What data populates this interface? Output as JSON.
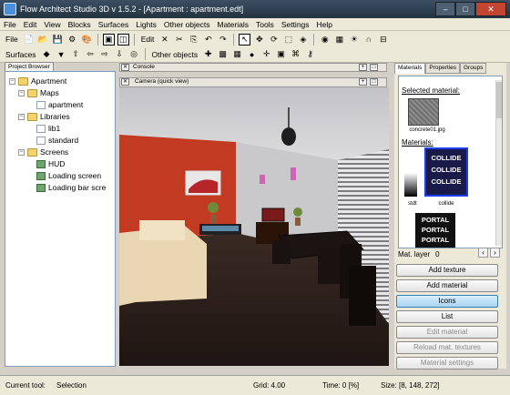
{
  "window": {
    "title": "Flow Architect Studio 3D v 1.5.2  - [Apartment : apartment.edt]",
    "minimize": "–",
    "maximize": "□",
    "close": "✕"
  },
  "menu": [
    "File",
    "Edit",
    "View",
    "Blocks",
    "Surfaces",
    "Lights",
    "Other objects",
    "Materials",
    "Tools",
    "Settings",
    "Help"
  ],
  "toolbar": {
    "file_label": "File",
    "edit_label": "Edit",
    "surfaces_label": "Surfaces",
    "other_objects_label": "Other objects"
  },
  "project_browser": {
    "tab": "Project Browser",
    "tree": {
      "root": "Apartment",
      "maps_label": "Maps",
      "maps": [
        "apartment"
      ],
      "libraries_label": "Libraries",
      "libraries": [
        "lib1",
        "standard"
      ],
      "screens_label": "Screens",
      "screens": [
        "HUD",
        "Loading screen",
        "Loading bar scre"
      ]
    }
  },
  "console": {
    "title": "Console"
  },
  "camera": {
    "title": "Camera (quick view)"
  },
  "materials_panel": {
    "tabs": [
      "Materials",
      "Properties",
      "Groups"
    ],
    "selected_label": "Selected material:",
    "selected_name": "concrete01.jpg",
    "materials_label": "Materials:",
    "items": [
      {
        "name": "stdt",
        "lines": []
      },
      {
        "name": "collide",
        "lines": [
          "COLLIDE",
          "COLLIDE",
          "COLLIDE"
        ]
      },
      {
        "name": "",
        "lines": [
          "PORTAL",
          "PORTAL",
          "PORTAL"
        ]
      }
    ],
    "mat_layer_label": "Mat. layer",
    "mat_layer_value": "0",
    "buttons": [
      {
        "label": "Add texture",
        "state": "normal"
      },
      {
        "label": "Add material",
        "state": "normal"
      },
      {
        "label": "Icons",
        "state": "selected"
      },
      {
        "label": "List",
        "state": "normal"
      },
      {
        "label": "Edit material",
        "state": "disabled"
      },
      {
        "label": "Reload mat. textures",
        "state": "disabled"
      },
      {
        "label": "Material settings",
        "state": "disabled"
      }
    ]
  },
  "status": {
    "current_tool_label": "Current tool:",
    "current_tool_value": "Selection",
    "grid": "Grid: 4.00",
    "time": "Time: 0 [%]",
    "size": "Size: [8, 148, 272]"
  },
  "colors": {
    "accent": "#3c7fb1",
    "titlebar": "#2e3f4f",
    "wall_red": "#c23a22",
    "floor": "#2a1e1a"
  }
}
